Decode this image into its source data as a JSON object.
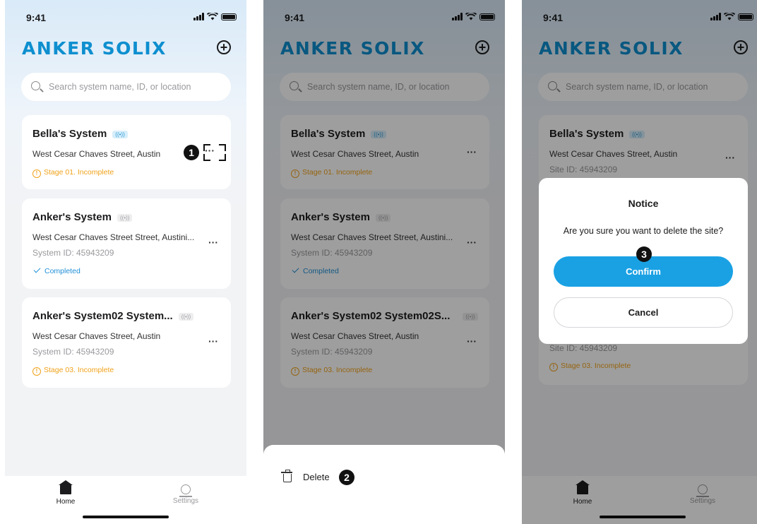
{
  "status": {
    "time": "9:41"
  },
  "app": {
    "logo": "ANKER SOLIX",
    "add_icon": "plus-circle-icon"
  },
  "search": {
    "placeholder": "Search system name, ID, or location"
  },
  "systems": [
    {
      "name": "Bella's System",
      "address": "West Cesar Chaves Street, Austin",
      "status": "Stage 01. Incomplete",
      "status_kind": "warning",
      "online": true
    },
    {
      "name": "Anker's System",
      "address": "West Cesar Chaves Street Street, Austini...",
      "system_id": "System ID: 45943209",
      "status": "Completed",
      "status_kind": "done",
      "online": false
    },
    {
      "name": "Anker's System02 System...",
      "name_wide": "Anker's System02 System02S...",
      "address": "West Cesar Chaves Street, Austin",
      "system_id": "System ID: 45943209",
      "status": "Stage 03. Incomplete",
      "status_kind": "warning",
      "online": false
    }
  ],
  "screen3": {
    "card1_site_id": "Site ID: 45943209",
    "card3_site_id": "Site ID: 45943209",
    "card3_status": "Stage 03. Incomplete"
  },
  "tabs": [
    {
      "label": "Home",
      "icon": "home-icon"
    },
    {
      "label": "Settings",
      "icon": "settings-icon"
    }
  ],
  "more_label": "···",
  "sheet": {
    "delete_label": "Delete",
    "icon": "trash-icon"
  },
  "dialog": {
    "title": "Notice",
    "message": "Are you sure you want to delete the site?",
    "confirm": "Confirm",
    "cancel": "Cancel"
  },
  "steps": [
    "1",
    "2",
    "3"
  ],
  "colors": {
    "brand": "#0e8fcf",
    "confirm_button": "#1aa1e4",
    "warning": "#f0a21a",
    "done": "#1e8fd6"
  }
}
